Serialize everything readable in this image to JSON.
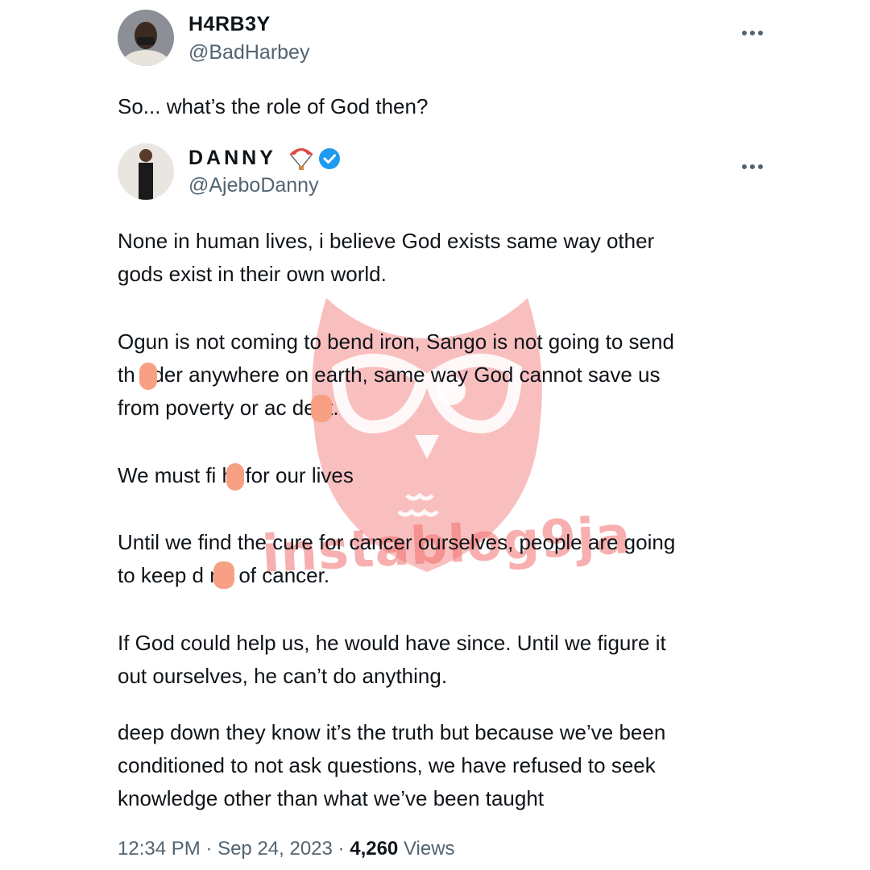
{
  "quoted_tweet": {
    "display_name": "H4RB3Y",
    "handle": "@BadHarbey",
    "text": "So... what’s the role of God then?"
  },
  "main_tweet": {
    "display_name": "DANNY",
    "name_emoji": "parachute-icon",
    "verified": true,
    "handle": "@AjeboDanny",
    "paragraphs": [
      [
        "None in human lives, i believe God exists same way other",
        "gods exist in their own world."
      ],
      [
        "Ogun is not coming to bend iron, Sango is not going to send",
        "th nder anywhere on earth, same way God cannot save us",
        "from poverty or ac dent."
      ],
      [
        "We must fi ht for our lives"
      ],
      [
        "Until we find the cure for cancer ourselves, people are going",
        "to keep d ng of cancer."
      ],
      [
        "If God could help us, he would have since. Until we figure it",
        "out ourselves, he can’t do anything."
      ],
      [
        "deep down they know it’s the truth but because we’ve been",
        "conditioned to not ask questions, we have refused to seek",
        "knowledge other than what we’ve been taught"
      ]
    ]
  },
  "meta": {
    "time": "12:34 PM",
    "date": "Sep 24, 2023",
    "separator": "·",
    "views_count": "4,260",
    "views_label": "Views"
  },
  "watermark": {
    "text": "instablog9ja",
    "color": "#f26e6e"
  }
}
